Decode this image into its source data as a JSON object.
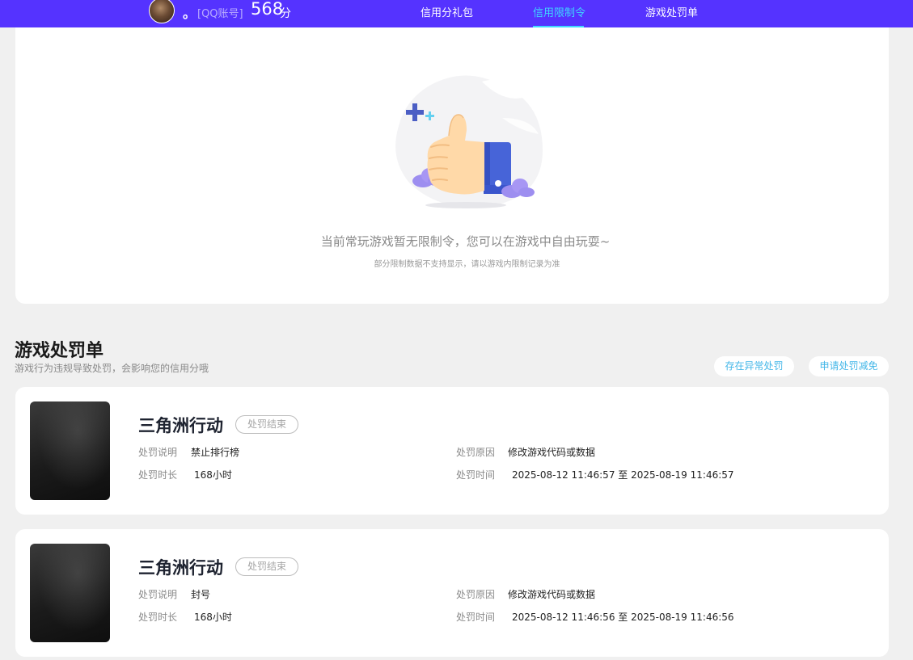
{
  "header": {
    "nickname": "。",
    "account_type": "[QQ账号]",
    "score": "568",
    "score_unit": "分",
    "nav": [
      {
        "label": "信用分礼包",
        "active": false
      },
      {
        "label": "信用限制令",
        "active": true
      },
      {
        "label": "游戏处罚单",
        "active": false
      }
    ],
    "accent_color": "#5533ff",
    "active_color": "#3fd7ff"
  },
  "limit": {
    "illustration": "thumbs-up-icon",
    "title": "当前常玩游戏暂无限制令，您可以在游戏中自由玩耍~",
    "subtitle": "部分限制数据不支持显示，请以游戏内限制记录为准"
  },
  "penalty_section": {
    "title": "游戏处罚单",
    "description": "游戏行为违规导致处罚，会影响您的信用分哦",
    "buttons": [
      "存在异常处罚",
      "申请处罚减免"
    ]
  },
  "penalties": [
    {
      "game": "三角洲行动",
      "status": "处罚结束",
      "desc_label": "处罚说明",
      "desc": "禁止排行榜",
      "reason_label": "处罚原因",
      "reason": "修改游戏代码或数据",
      "duration_label": "处罚时长",
      "duration": "168小时",
      "time_label": "处罚时间",
      "time": "2025-08-12 11:46:57 至 2025-08-19 11:46:57"
    },
    {
      "game": "三角洲行动",
      "status": "处罚结束",
      "desc_label": "处罚说明",
      "desc": "封号",
      "reason_label": "处罚原因",
      "reason": "修改游戏代码或数据",
      "duration_label": "处罚时长",
      "duration": "168小时",
      "time_label": "处罚时间",
      "time": "2025-08-12 11:46:56 至 2025-08-19 11:46:56"
    }
  ]
}
